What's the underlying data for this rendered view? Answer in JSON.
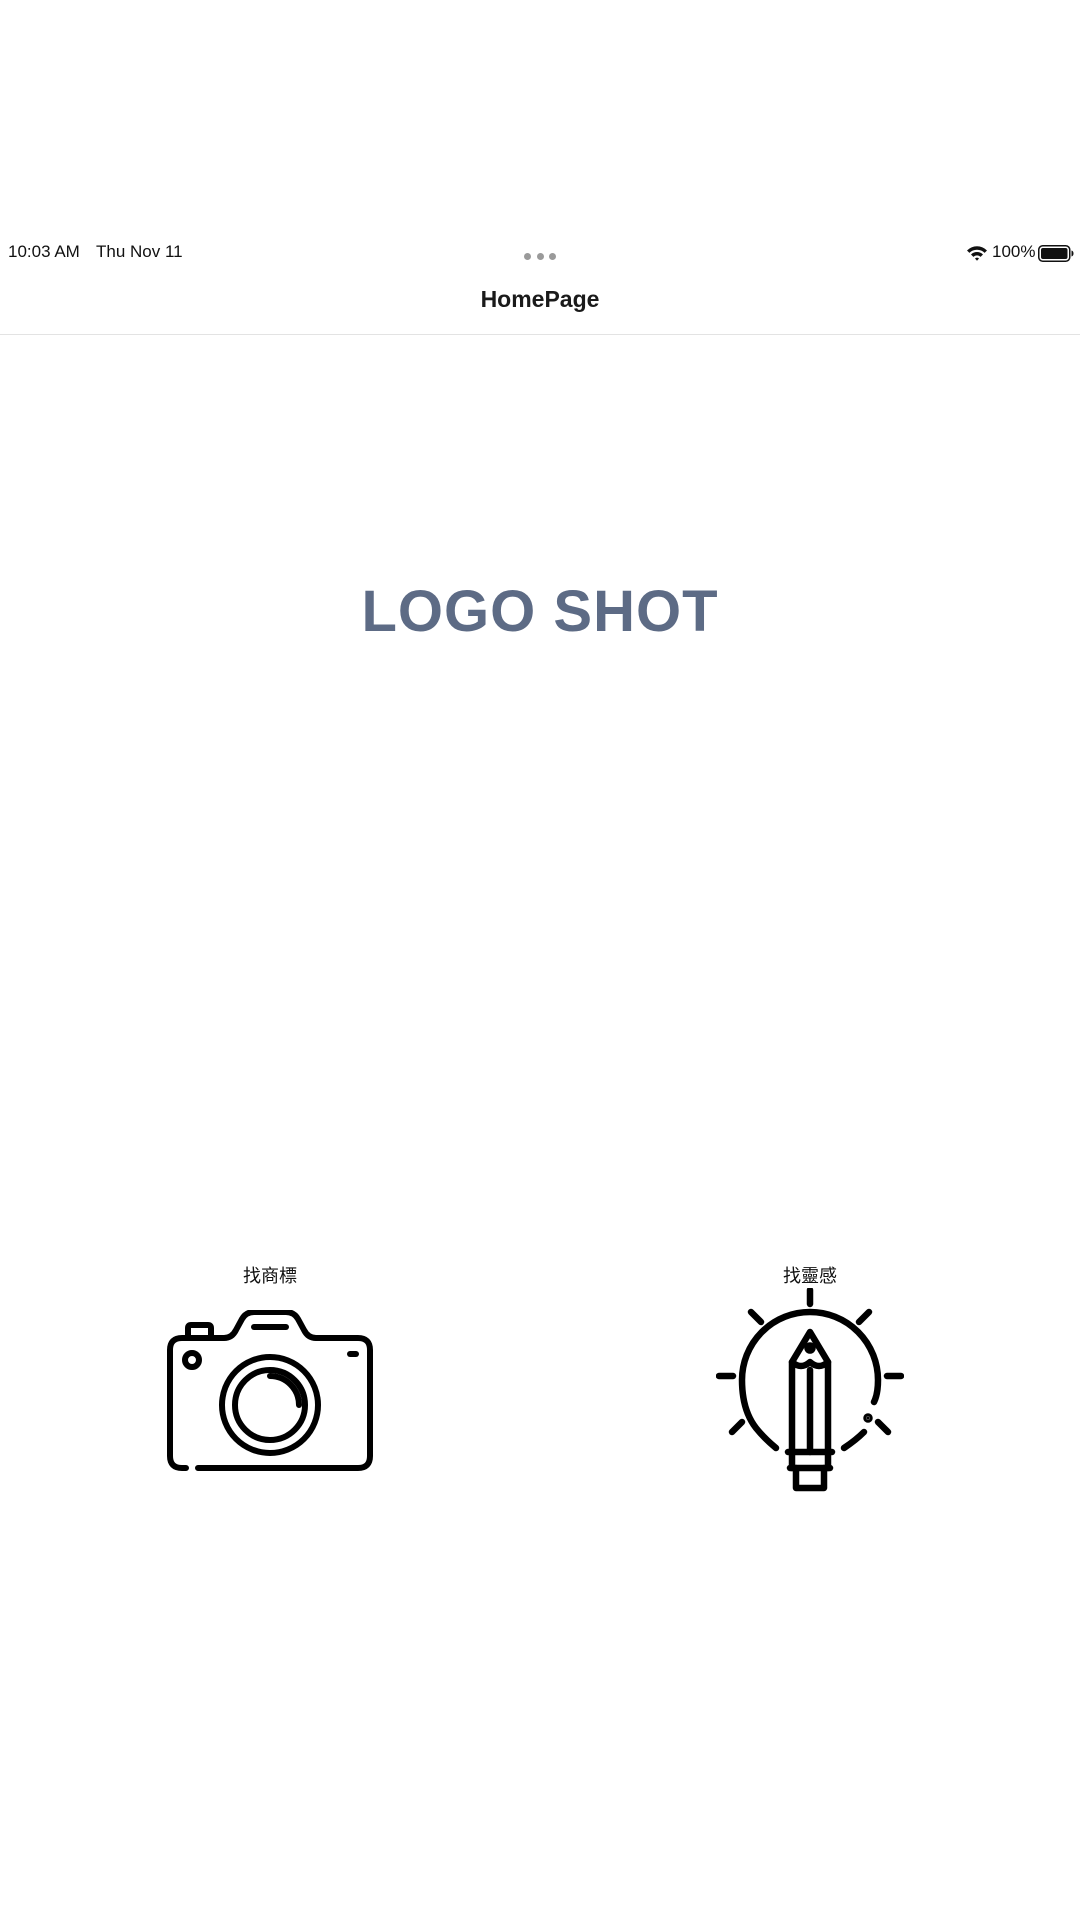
{
  "status_bar": {
    "time": "10:03 AM",
    "date": "Thu Nov 11",
    "battery_percent": "100%",
    "battery_level": 1.0,
    "wifi_icon": "wifi-icon",
    "battery_icon": "battery-icon"
  },
  "nav": {
    "title": "HomePage"
  },
  "main": {
    "logo_text": "LOGO SHOT",
    "logo_color": "#5d6b85"
  },
  "actions": [
    {
      "label": "找商標",
      "icon": "camera-icon"
    },
    {
      "label": "找靈感",
      "icon": "lightbulb-pencil-icon"
    }
  ]
}
